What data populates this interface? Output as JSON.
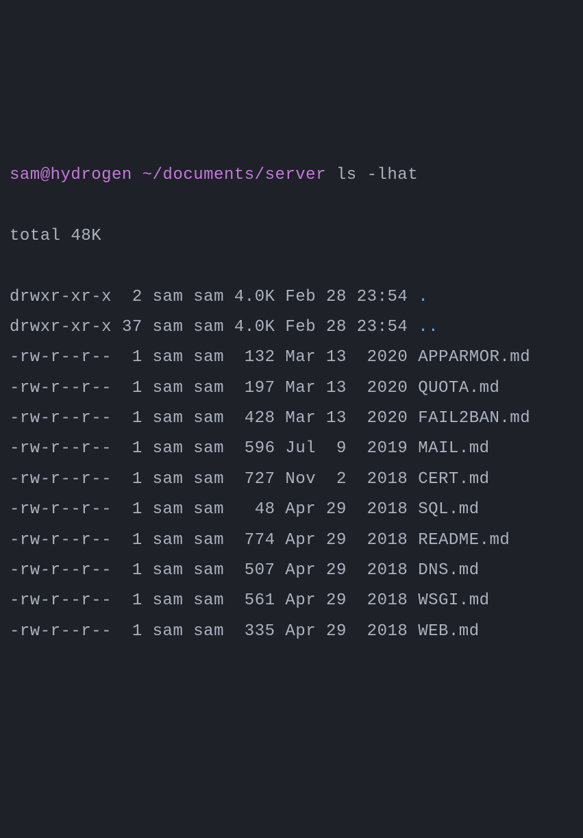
{
  "prompt": {
    "user_host": "sam@hydrogen",
    "path": "~/documents/server",
    "command": "ls -lhat"
  },
  "total": "total 48K",
  "rows": [
    {
      "perm": "drwxr-xr-x",
      "links": " 2",
      "user": "sam",
      "group": "sam",
      "size": "4.0K",
      "month": "Feb",
      "day": "28",
      "tm": "23:54",
      "name": ".",
      "dir": true
    },
    {
      "perm": "drwxr-xr-x",
      "links": "37",
      "user": "sam",
      "group": "sam",
      "size": "4.0K",
      "month": "Feb",
      "day": "28",
      "tm": "23:54",
      "name": "..",
      "dir": true
    },
    {
      "perm": "-rw-r--r--",
      "links": " 1",
      "user": "sam",
      "group": "sam",
      "size": " 132",
      "month": "Mar",
      "day": "13",
      "tm": " 2020",
      "name": "APPARMOR.md",
      "dir": false
    },
    {
      "perm": "-rw-r--r--",
      "links": " 1",
      "user": "sam",
      "group": "sam",
      "size": " 197",
      "month": "Mar",
      "day": "13",
      "tm": " 2020",
      "name": "QUOTA.md",
      "dir": false
    },
    {
      "perm": "-rw-r--r--",
      "links": " 1",
      "user": "sam",
      "group": "sam",
      "size": " 428",
      "month": "Mar",
      "day": "13",
      "tm": " 2020",
      "name": "FAIL2BAN.md",
      "dir": false
    },
    {
      "perm": "-rw-r--r--",
      "links": " 1",
      "user": "sam",
      "group": "sam",
      "size": " 596",
      "month": "Jul",
      "day": " 9",
      "tm": " 2019",
      "name": "MAIL.md",
      "dir": false
    },
    {
      "perm": "-rw-r--r--",
      "links": " 1",
      "user": "sam",
      "group": "sam",
      "size": " 727",
      "month": "Nov",
      "day": " 2",
      "tm": " 2018",
      "name": "CERT.md",
      "dir": false
    },
    {
      "perm": "-rw-r--r--",
      "links": " 1",
      "user": "sam",
      "group": "sam",
      "size": "  48",
      "month": "Apr",
      "day": "29",
      "tm": " 2018",
      "name": "SQL.md",
      "dir": false
    },
    {
      "perm": "-rw-r--r--",
      "links": " 1",
      "user": "sam",
      "group": "sam",
      "size": " 774",
      "month": "Apr",
      "day": "29",
      "tm": " 2018",
      "name": "README.md",
      "dir": false
    },
    {
      "perm": "-rw-r--r--",
      "links": " 1",
      "user": "sam",
      "group": "sam",
      "size": " 507",
      "month": "Apr",
      "day": "29",
      "tm": " 2018",
      "name": "DNS.md",
      "dir": false
    },
    {
      "perm": "-rw-r--r--",
      "links": " 1",
      "user": "sam",
      "group": "sam",
      "size": " 561",
      "month": "Apr",
      "day": "29",
      "tm": " 2018",
      "name": "WSGI.md",
      "dir": false
    },
    {
      "perm": "-rw-r--r--",
      "links": " 1",
      "user": "sam",
      "group": "sam",
      "size": " 335",
      "month": "Apr",
      "day": "29",
      "tm": " 2018",
      "name": "WEB.md",
      "dir": false
    }
  ]
}
